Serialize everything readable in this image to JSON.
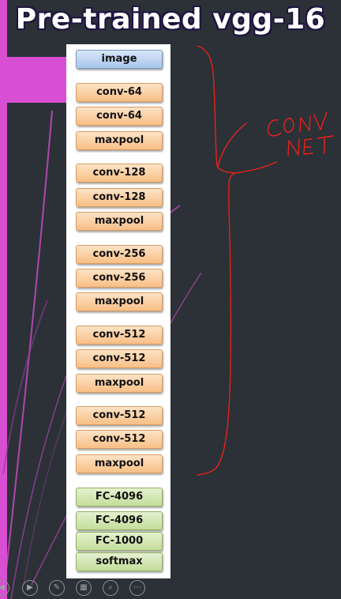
{
  "slide": {
    "title": "Pre-trained vgg-16",
    "accent_color": "#d94fd3",
    "background_color": "#2b3137"
  },
  "layers": [
    {
      "label": "image",
      "kind": "input"
    },
    {
      "label": "conv-64",
      "kind": "conv"
    },
    {
      "label": "conv-64",
      "kind": "conv"
    },
    {
      "label": "maxpool",
      "kind": "conv"
    },
    {
      "label": "conv-128",
      "kind": "conv"
    },
    {
      "label": "conv-128",
      "kind": "conv"
    },
    {
      "label": "maxpool",
      "kind": "conv"
    },
    {
      "label": "conv-256",
      "kind": "conv"
    },
    {
      "label": "conv-256",
      "kind": "conv"
    },
    {
      "label": "maxpool",
      "kind": "conv"
    },
    {
      "label": "conv-512",
      "kind": "conv"
    },
    {
      "label": "conv-512",
      "kind": "conv"
    },
    {
      "label": "maxpool",
      "kind": "conv"
    },
    {
      "label": "conv-512",
      "kind": "conv"
    },
    {
      "label": "conv-512",
      "kind": "conv"
    },
    {
      "label": "maxpool",
      "kind": "conv"
    },
    {
      "label": "FC-4096",
      "kind": "fc"
    },
    {
      "label": "FC-4096",
      "kind": "fc"
    },
    {
      "label": "FC-1000",
      "kind": "fc"
    },
    {
      "label": "softmax",
      "kind": "fc"
    }
  ],
  "annotation": {
    "text": "CONV NET",
    "color": "#e8211b"
  },
  "slideshow_controls": [
    {
      "icon": "previous-slide-icon"
    },
    {
      "icon": "next-slide-icon"
    },
    {
      "icon": "pen-icon"
    },
    {
      "icon": "slide-overview-icon"
    },
    {
      "icon": "zoom-icon"
    },
    {
      "icon": "more-options-icon"
    }
  ]
}
